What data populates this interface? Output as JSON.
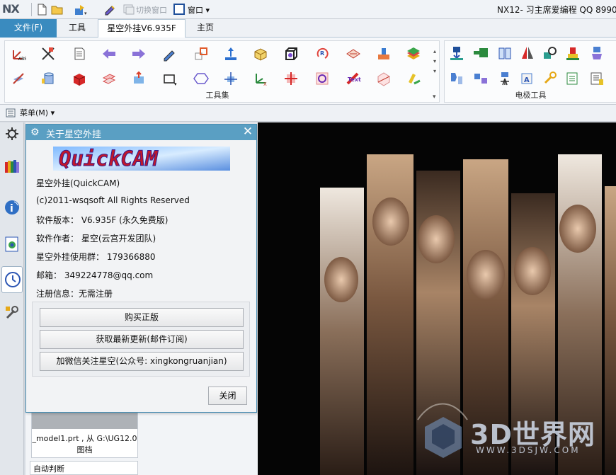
{
  "titlebar": {
    "logo": "NX",
    "switch_window": "切换窗口",
    "window_menu": "窗口",
    "app_title": "NX12- 习主席爱编程 QQ 8990"
  },
  "tabs": {
    "file": "文件(F)",
    "tools": "工具",
    "xingkong": "星空外挂V6.935F",
    "home": "主页"
  },
  "ribbon": {
    "group1_label": "工具集",
    "group2_label": "电极工具"
  },
  "menubar": {
    "menu_label": "菜单(M)"
  },
  "nav_panel": {
    "file_card": "_model1.prt , 从 G:\\UG12.0图档",
    "auto_judge": "自动判断"
  },
  "dialog": {
    "title": "关于星空外挂",
    "logo_text": "QuickCAM",
    "product": "星空外挂(QuickCAM)",
    "copyright": "(c)2011-wsqsoft All Rights Reserved",
    "version": "软件版本： V6.935F (永久免费版)",
    "author": "软件作者： 星空(云宫开发团队)",
    "group": "星空外挂使用群： 179366880",
    "email": "邮箱： 349224778@qq.com",
    "registration": "注册信息：无需注册",
    "buttons": {
      "buy": "购买正版",
      "updates": "获取最新更新(邮件订阅)",
      "wechat": "加微信关注星空(公众号: xingkongruanjian)",
      "close": "关闭"
    }
  },
  "watermark": {
    "brand": "3D世界网",
    "url": "WWW.3DSJW.COM"
  },
  "colors": {
    "accent": "#3a8bbf",
    "dialog_header": "#5a9fc3",
    "graphics_bg": "#050505"
  },
  "icons": [
    "gear-icon",
    "close-icon",
    "new-file-icon",
    "open-folder-icon",
    "clock-icon",
    "books-icon",
    "info-icon"
  ]
}
